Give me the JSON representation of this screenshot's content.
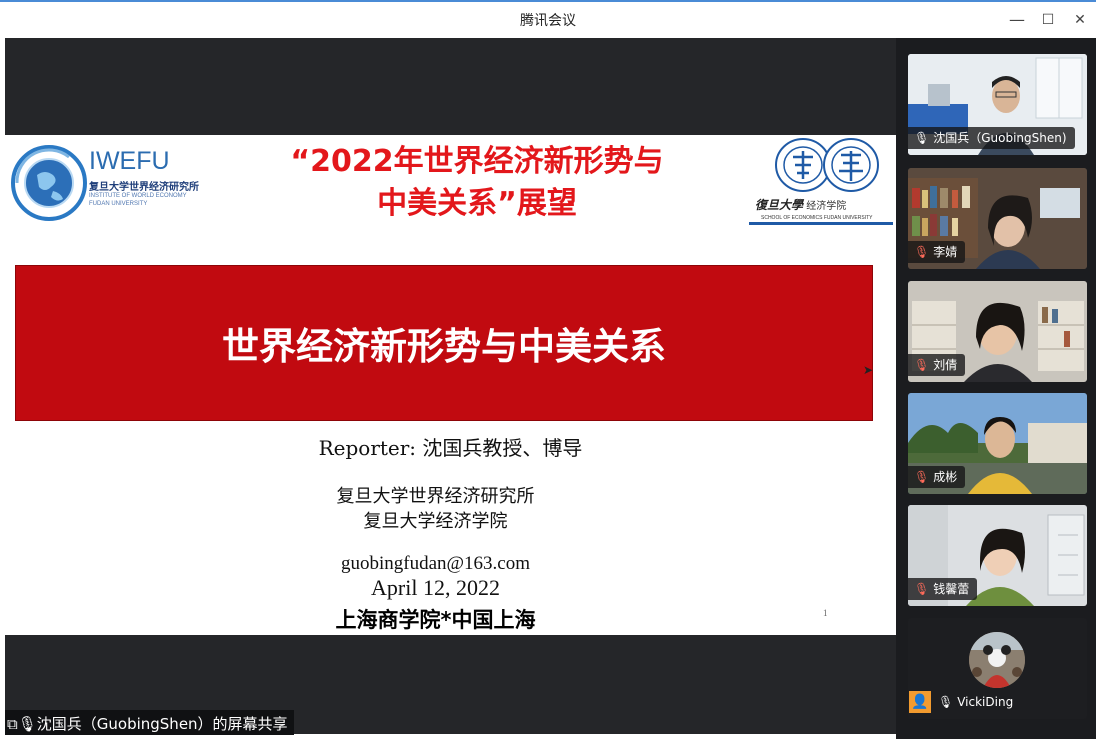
{
  "window": {
    "title": "腾讯会议",
    "minimize": "—",
    "maximize": "☐",
    "close": "✕"
  },
  "slide": {
    "logo_left": {
      "brand": "IWEFU",
      "cn": "复旦大学世界经济研究所",
      "en1": "INSTITUTE OF WORLD ECONOMY",
      "en2": "FUDAN UNIVERSITY"
    },
    "title_line1": "“2022年世界经济新形势与",
    "title_line2": "中美关系”展望",
    "logo_right": {
      "calligraphy": "復旦大學",
      "school": "经济学院",
      "en": "SCHOOL OF ECONOMICS FUDAN UNIVERSITY"
    },
    "banner": "世界经济新形势与中美关系",
    "reporter": "Reporter: 沈国兵教授、博导",
    "institute1": "复旦大学世界经济研究所",
    "institute2": "复旦大学经济学院",
    "email": "guobingfudan@163.com",
    "date": "April 12, 2022",
    "place": "上海商学院*中国上海",
    "page_number": "1"
  },
  "share_label": "沈国兵（GuobingShen）的屏幕共享",
  "participants": [
    {
      "name": "沈国兵（GuobingShen)",
      "mic": "on"
    },
    {
      "name": "李婧",
      "mic": "muted"
    },
    {
      "name": "刘倩",
      "mic": "muted"
    },
    {
      "name": "成彬",
      "mic": "muted"
    },
    {
      "name": "钱馨蕾",
      "mic": "muted"
    },
    {
      "name": "VickiDing",
      "mic": "on"
    }
  ],
  "colors": {
    "accent_red": "#e3171b",
    "banner_red": "#c10a10",
    "panel_bg": "#1b1c1f",
    "main_bg": "#252629"
  },
  "icons": {
    "mic_on": "mic-icon",
    "mic_muted": "mic-muted-icon",
    "host": "host-icon",
    "share": "screen-share-icon"
  }
}
